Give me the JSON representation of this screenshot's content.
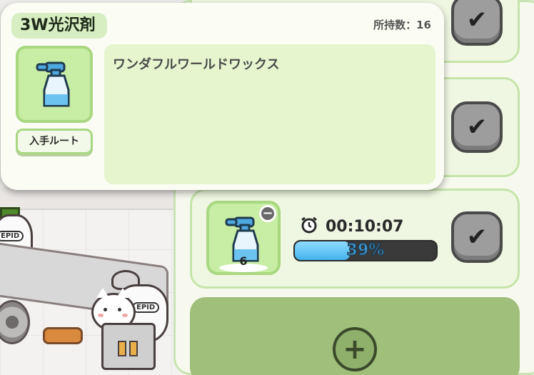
{
  "popup": {
    "title": "3W光沢剤",
    "owned_label": "所持数：16",
    "item_icon": "spray-bottle-icon",
    "route_button": "入手ルート",
    "description": "ワンダフルワールドワックス"
  },
  "tasks": {
    "active": {
      "item_icon": "spray-bottle-icon",
      "quantity": "6",
      "timer": "00:10:07",
      "timer_icon": "alarm-clock-icon",
      "progress_label": "39%",
      "progress_fraction": 0.39
    },
    "check_icon": "checkmark-icon",
    "add_icon": "plus-icon",
    "remove_icon": "minus-icon"
  },
  "scene": {
    "sack_tag": "EPID"
  },
  "colors": {
    "accent_green": "#c8eda4",
    "progress_blue": "#43b3ee",
    "button_grey": "#9d9d9d"
  }
}
